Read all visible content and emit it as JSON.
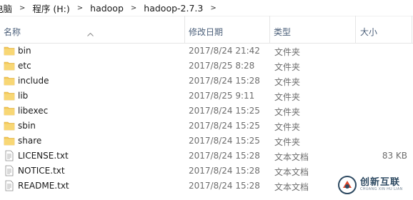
{
  "breadcrumb": [
    "电脑",
    "程序 (H:)",
    "hadoop",
    "hadoop-2.7.3"
  ],
  "columns": {
    "name": "名称",
    "modified": "修改日期",
    "type": "类型",
    "size": "大小"
  },
  "files": [
    {
      "name": "bin",
      "modified": "2017/8/24 21:42",
      "type": "文件夹",
      "size": "",
      "icon": "folder-icon"
    },
    {
      "name": "etc",
      "modified": "2017/8/25 8:28",
      "type": "文件夹",
      "size": "",
      "icon": "folder-icon"
    },
    {
      "name": "include",
      "modified": "2017/8/24 15:28",
      "type": "文件夹",
      "size": "",
      "icon": "folder-icon"
    },
    {
      "name": "lib",
      "modified": "2017/8/25 9:11",
      "type": "文件夹",
      "size": "",
      "icon": "folder-icon"
    },
    {
      "name": "libexec",
      "modified": "2017/8/24 15:25",
      "type": "文件夹",
      "size": "",
      "icon": "folder-icon"
    },
    {
      "name": "sbin",
      "modified": "2017/8/24 15:25",
      "type": "文件夹",
      "size": "",
      "icon": "folder-icon"
    },
    {
      "name": "share",
      "modified": "2017/8/24 15:25",
      "type": "文件夹",
      "size": "",
      "icon": "folder-icon"
    },
    {
      "name": "LICENSE.txt",
      "modified": "2017/8/24 15:28",
      "type": "文本文档",
      "size": "83 KB",
      "icon": "text-file-icon"
    },
    {
      "name": "NOTICE.txt",
      "modified": "2017/8/24 15:28",
      "type": "文本文档",
      "size": "",
      "icon": "text-file-icon"
    },
    {
      "name": "README.txt",
      "modified": "2017/8/24 15:28",
      "type": "文本文档",
      "size": "",
      "icon": "text-file-icon"
    }
  ],
  "watermark": {
    "main": "创新互联",
    "sub": "CHUANG XIN HU LIAN"
  },
  "colors": {
    "folder": "#f3c95b",
    "header_text": "#4c607a",
    "muted_text": "#6d6d6d"
  }
}
